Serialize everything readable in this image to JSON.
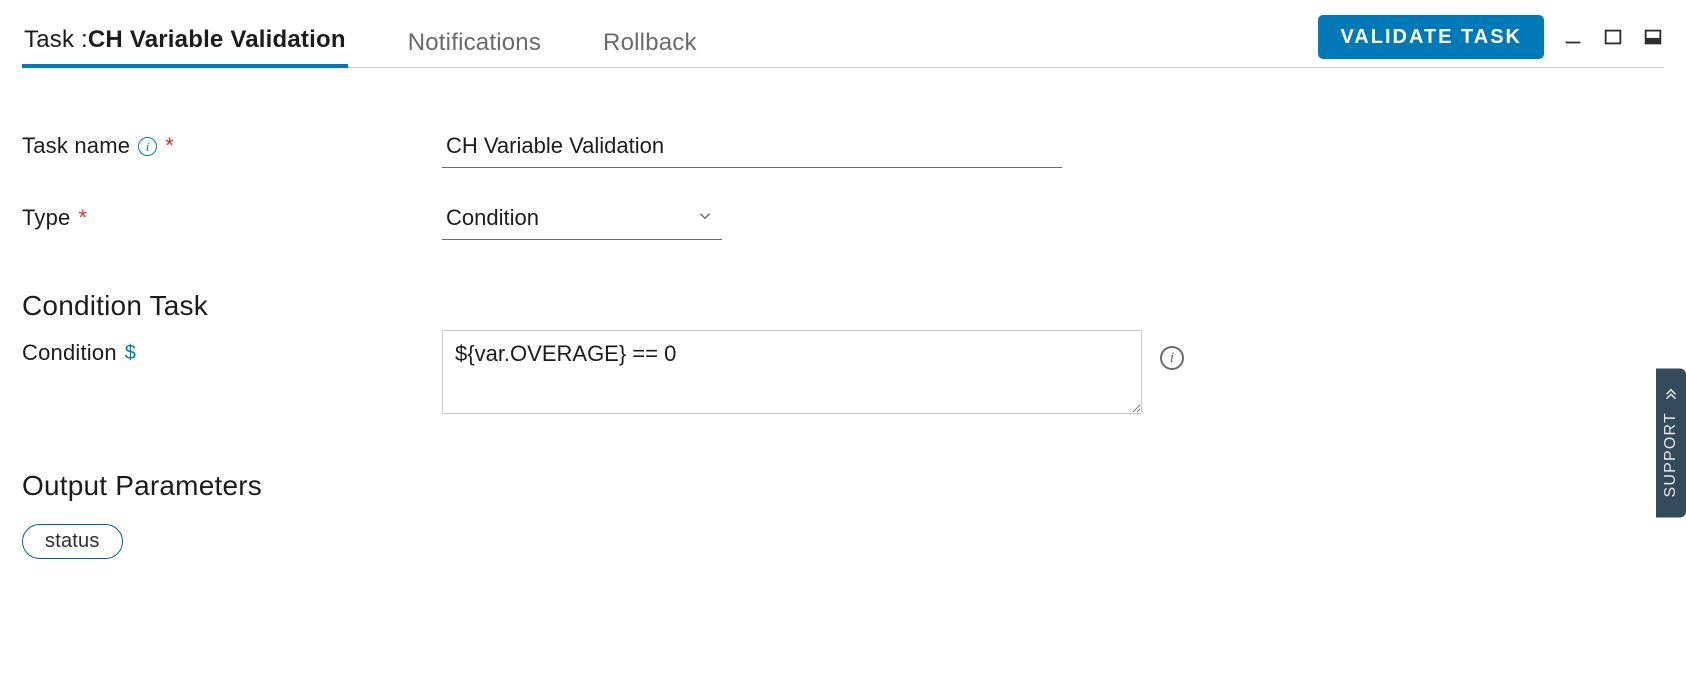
{
  "tabs": {
    "task_prefix": "Task :",
    "task_bold": "CH Variable Validation",
    "notifications": "Notifications",
    "rollback": "Rollback"
  },
  "actions": {
    "validate": "VALIDATE TASK"
  },
  "form": {
    "task_name_label": "Task name",
    "task_name_value": "CH Variable Validation",
    "type_label": "Type",
    "type_value": "Condition",
    "section_condition": "Condition Task",
    "condition_label": "Condition",
    "condition_value": "${var.OVERAGE} == 0",
    "section_output": "Output Parameters",
    "chip_status": "status"
  },
  "support": {
    "label": "SUPPORT"
  }
}
